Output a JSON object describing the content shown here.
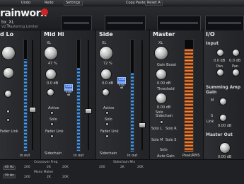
{
  "toolbar": {
    "items": [
      "Undo",
      "Redo",
      "Settings",
      "Copy",
      "Paste",
      "Reset A"
    ]
  },
  "header": {
    "brand": "rainworx",
    "product": "bx_XL",
    "subtitle": "V2 Mastering Limiter"
  },
  "strips": {
    "band_lo": {
      "title": "d Lo",
      "val_b": "in out",
      "link": "Fader Link"
    },
    "mid_hi": {
      "title": "Mid Hi",
      "xl": "XL",
      "pct": "47 %",
      "pct2": "0.0 dB",
      "gain_badge": "GAIN Boost 0.00 dB",
      "active": "Active",
      "solo": "Solo",
      "link": "Fader Link",
      "sidechain": "Sidechain",
      "meter_lbl": "in out"
    },
    "side": {
      "title": "Side",
      "xl": "XL",
      "pct": "72 %",
      "pct2": "0.0 dB",
      "gain_badge": "GAIN Boost 0.00 dB",
      "active": "Active",
      "solo": "Solo",
      "link": "Fader Link",
      "sidechain": "Sidechain",
      "meter_lbl": "in out"
    },
    "master": {
      "title": "Master",
      "xl": "XL",
      "gain_boost": "Gain Boost",
      "db1": "0.00 dB",
      "threshold": "Threshold",
      "db2": "0.00 dB",
      "solo_sel": "Solo Sidechain",
      "solo_l": "Solo L",
      "solo_r": "Solo R",
      "solo_m": "Solo M",
      "solo_s": "Solo S",
      "solo": "Solo",
      "auto_gain": "Auto Gain",
      "peak_rms": "Peak/RMS"
    },
    "io": {
      "title": "I/O",
      "input": "Input",
      "in_l": "0.0 dB",
      "in_r": "0.0 dB",
      "pan_l": "Pan",
      "pan_r": "Pan",
      "summing": "Summing Amp Gain",
      "sum_m": "M",
      "sum_s": "S",
      "sum_val": "0.00 dB",
      "link": "Link",
      "master_out": "Master Out",
      "out_db": "0.00 dB"
    }
  },
  "crossover": {
    "left_pills": [
      "40 Hz",
      "70 Hz"
    ],
    "title": "Crossover Freq",
    "mono_maker": "Mono Maker",
    "ticks_a": [
      "200",
      "2K",
      "20K"
    ],
    "ticks_b": [
      "200",
      "2K",
      "20K"
    ],
    "sidechain": "Sidechain Mix",
    "ticks_c": [
      "200",
      "2K",
      "20K"
    ]
  }
}
